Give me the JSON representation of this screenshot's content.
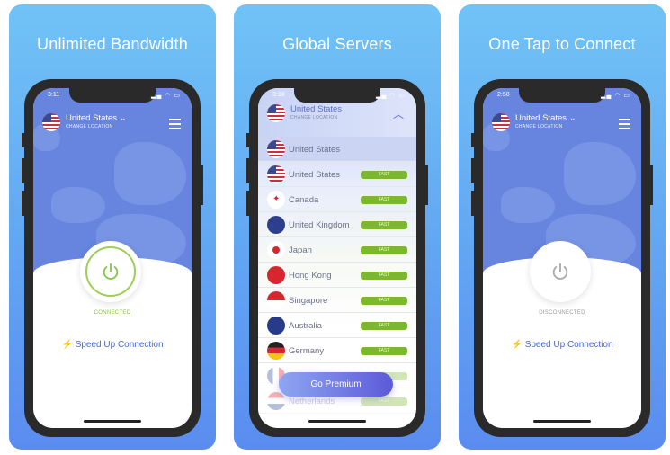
{
  "colors": {
    "connected": "#8bc34a",
    "accent": "#4a68d6",
    "fast": "#7cb82f",
    "map": "#6784de"
  },
  "panels": [
    {
      "title": "Unlimited Bandwidth",
      "time": "3:11",
      "location": "United States",
      "change": "CHANGE LOCATION",
      "state": "CONNECTED",
      "speed": "Speed Up Connection"
    },
    {
      "title": "Global Servers",
      "time": "3:18",
      "location": "United States",
      "change": "CHANGE LOCATION",
      "selected": "United States",
      "servers": [
        {
          "name": "United States",
          "badge": "FAST"
        },
        {
          "name": "Canada",
          "badge": "FAST"
        },
        {
          "name": "United Kingdom",
          "badge": "FAST"
        },
        {
          "name": "Japan",
          "badge": "FAST"
        },
        {
          "name": "Hong Kong",
          "badge": "FAST"
        },
        {
          "name": "Singapore",
          "badge": "FAST"
        },
        {
          "name": "Australia",
          "badge": "FAST"
        },
        {
          "name": "Germany",
          "badge": "FAST"
        },
        {
          "name": "France",
          "badge": "FAST"
        },
        {
          "name": "Netherlands",
          "badge": "FAST"
        }
      ],
      "premium": "Go Premium"
    },
    {
      "title": "One Tap to Connect",
      "time": "2:58",
      "location": "United States",
      "change": "CHANGE LOCATION",
      "state": "DISCONNECTED",
      "speed": "Speed Up Connection"
    }
  ]
}
